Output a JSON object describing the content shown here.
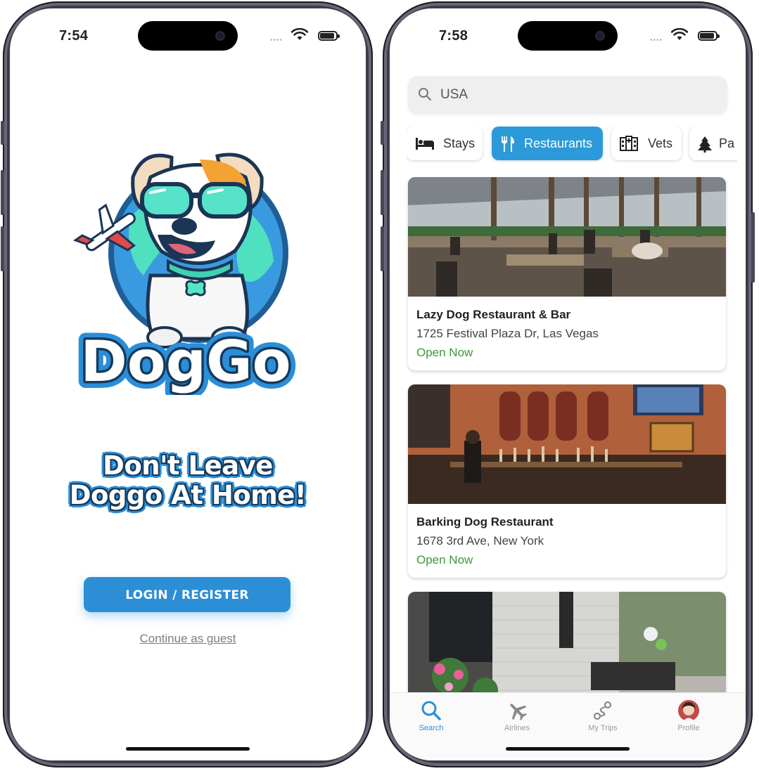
{
  "left_screen": {
    "status_time": "7:54",
    "logo_text": "DogGo",
    "tagline_line1": "Don't Leave",
    "tagline_line2": "Doggo At Home!",
    "login_button": "LOGIN / REGISTER",
    "guest_link": "Continue as guest"
  },
  "right_screen": {
    "status_time": "7:58",
    "search": {
      "value": "USA",
      "icon": "search-icon"
    },
    "categories": [
      {
        "label": "Stays",
        "icon": "bed-icon",
        "active": false
      },
      {
        "label": "Restaurants",
        "icon": "fork-knife-icon",
        "active": true
      },
      {
        "label": "Vets",
        "icon": "hospital-icon",
        "active": false
      },
      {
        "label": "Pa",
        "icon": "tree-icon",
        "active": false
      }
    ],
    "results": [
      {
        "name": "Lazy Dog Restaurant & Bar",
        "address": "1725 Festival Plaza Dr, Las Vegas",
        "status": "Open Now"
      },
      {
        "name": "Barking Dog Restaurant",
        "address": "1678 3rd Ave, New York",
        "status": "Open Now"
      }
    ],
    "tabs": [
      {
        "label": "Search",
        "icon": "search-icon",
        "active": true
      },
      {
        "label": "Airlines",
        "icon": "airplane-icon",
        "active": false
      },
      {
        "label": "My Trips",
        "icon": "route-icon",
        "active": false
      },
      {
        "label": "Profile",
        "icon": "avatar-icon",
        "active": false
      }
    ]
  },
  "colors": {
    "accent": "#2c8fd6",
    "open_green": "#3a9a3a",
    "frame": "#3f3b4a"
  }
}
